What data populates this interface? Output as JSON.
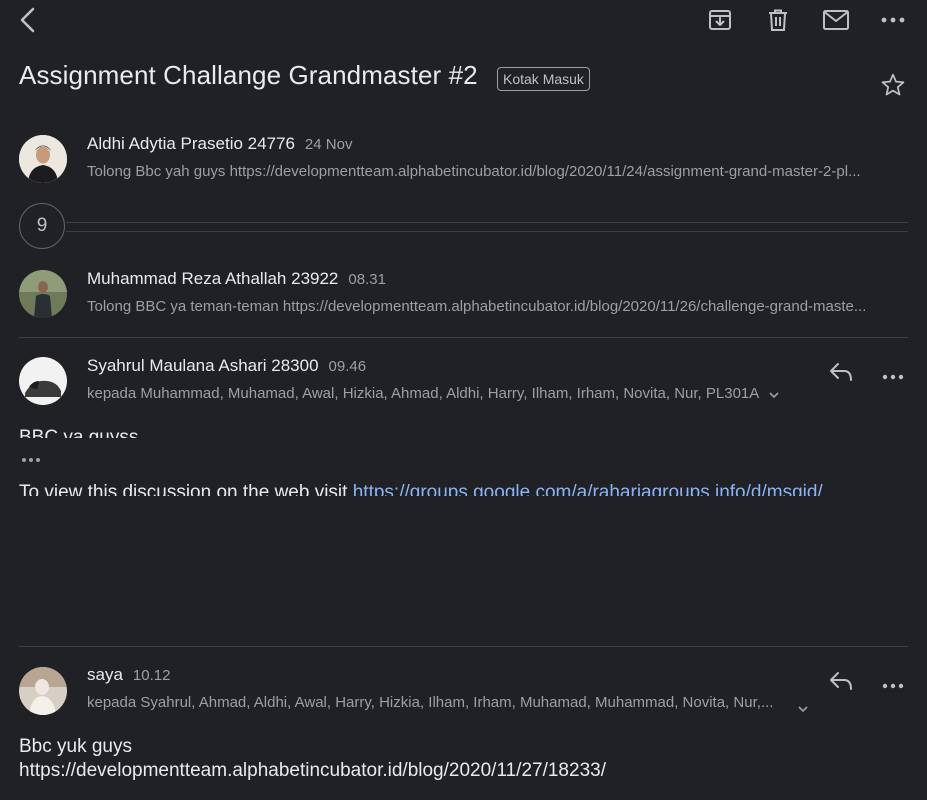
{
  "toolbar": {
    "back_icon": "chevron-left-icon",
    "archive_icon": "archive-icon",
    "delete_icon": "trash-icon",
    "mark_unread_icon": "envelope-icon",
    "more_icon": "more-horizontal-icon"
  },
  "thread": {
    "subject": "Assignment Challange Grandmaster #2",
    "label": "Kotak Masuk",
    "star_icon": "star-outline-icon",
    "collapsed_count": "9"
  },
  "messages": [
    {
      "sender": "Aldhi Adytia Prasetio 24776",
      "time": "24 Nov",
      "snippet": "Tolong Bbc yah guys https://developmentteam.alphabetincubator.id/blog/2020/11/24/assignment-grand-master-2-pl..."
    },
    {
      "sender": "Muhammad Reza Athallah 23922",
      "time": "08.31",
      "snippet": "Tolong BBC ya teman-teman https://developmentteam.alphabetincubator.id/blog/2020/11/26/challenge-grand-maste..."
    },
    {
      "sender": "Syahrul Maulana Ashari 28300",
      "time": "09.46",
      "recipients": "kepada Muhammad, Muhamad, Awal, Hizkia, Ahmad, Aldhi, Harry, Ilham, Irham, Novita, Nur, PL301A",
      "body_line1": "BBC ya guyss",
      "body_line2_prefix": "To view this discussion on the web visit ",
      "body_line2_link": "https://groups.google.com/a/rahariagroups.info/d/msgid/"
    },
    {
      "sender": "saya",
      "time": "10.12",
      "recipients": "kepada Syahrul, Ahmad, Aldhi, Awal, Harry, Hizkia, Ilham, Irham, Muhamad, Muhammad, Novita, Nur,...",
      "body_line1": "Bbc yuk guys",
      "body_line2": "https://developmentteam.alphabetincubator.id/blog/2020/11/27/18233/"
    }
  ]
}
